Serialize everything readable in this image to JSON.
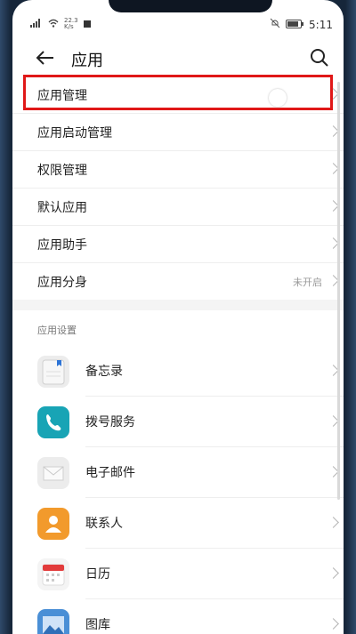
{
  "status_bar": {
    "network": "22.3",
    "network_unit": "K/s",
    "time": "5:11"
  },
  "header": {
    "title": "应用"
  },
  "menu_items": [
    {
      "label": "应用管理",
      "value": ""
    },
    {
      "label": "应用启动管理",
      "value": ""
    },
    {
      "label": "权限管理",
      "value": ""
    },
    {
      "label": "默认应用",
      "value": ""
    },
    {
      "label": "应用助手",
      "value": ""
    },
    {
      "label": "应用分身",
      "value": "未开启"
    }
  ],
  "settings_section": {
    "title": "应用设置",
    "apps": [
      {
        "label": "备忘录",
        "icon": "notepad-icon",
        "color": "#e8e8e8"
      },
      {
        "label": "拨号服务",
        "icon": "phone-icon",
        "color": "#1aa6b7"
      },
      {
        "label": "电子邮件",
        "icon": "mail-icon",
        "color": "#e9e9e9"
      },
      {
        "label": "联系人",
        "icon": "contacts-icon",
        "color": "#f39a2b"
      },
      {
        "label": "日历",
        "icon": "calendar-icon",
        "color": "#e23b3b"
      },
      {
        "label": "图库",
        "icon": "gallery-icon",
        "color": "#4a8fd6"
      }
    ]
  },
  "highlight_color": "#e01818"
}
